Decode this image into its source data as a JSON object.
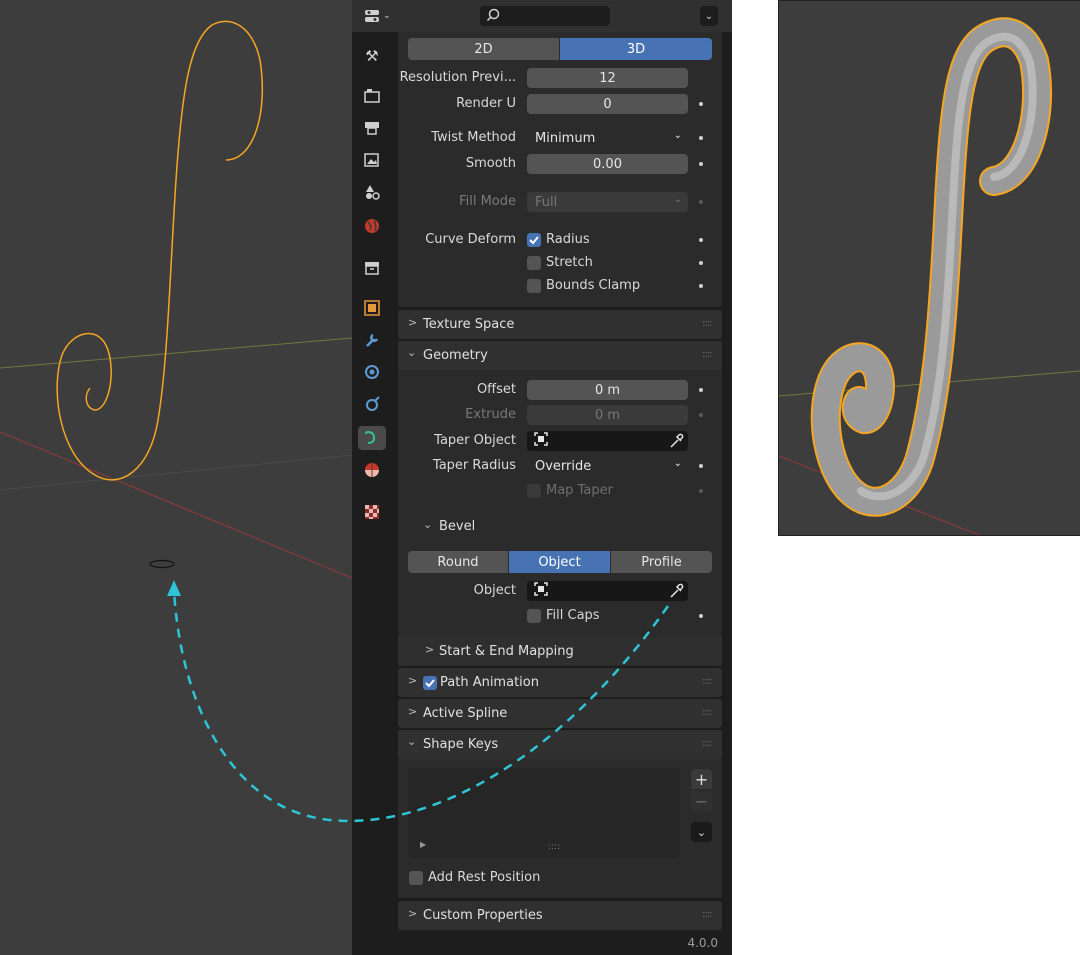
{
  "header": {
    "editor_type_icon": "properties-editor-icon",
    "search_placeholder": ""
  },
  "tabs": [
    {
      "name": "tool-tab",
      "icon": "wrench-screwdriver-icon"
    },
    {
      "name": "render-tab",
      "icon": "camera-back-icon"
    },
    {
      "name": "output-tab",
      "icon": "printer-icon"
    },
    {
      "name": "view-layer-tab",
      "icon": "image-stack-icon"
    },
    {
      "name": "scene-tab",
      "icon": "shapes-icon"
    },
    {
      "name": "world-tab",
      "icon": "globe-icon"
    },
    {
      "name": "collection-tab",
      "icon": "box-icon"
    },
    {
      "name": "object-tab",
      "icon": "orange-square-icon"
    },
    {
      "name": "modifier-tab",
      "icon": "wrench-icon"
    },
    {
      "name": "particles-tab",
      "icon": "physics-circle-icon"
    },
    {
      "name": "constraints-tab",
      "icon": "constraint-icon"
    },
    {
      "name": "data-tab",
      "icon": "curve-icon"
    },
    {
      "name": "material-tab",
      "icon": "material-sphere-icon"
    },
    {
      "name": "texture-tab",
      "icon": "checker-icon"
    }
  ],
  "shape": {
    "mode_2d": "2D",
    "mode_3d": "3D",
    "resolution_preview_label": "Resolution Previ...",
    "resolution_preview_value": "12",
    "render_u_label": "Render U",
    "render_u_value": "0",
    "twist_method_label": "Twist Method",
    "twist_method_value": "Minimum",
    "smooth_label": "Smooth",
    "smooth_value": "0.00",
    "fill_mode_label": "Fill Mode",
    "fill_mode_value": "Full",
    "curve_deform_label": "Curve Deform",
    "radius_label": "Radius",
    "stretch_label": "Stretch",
    "bounds_clamp_label": "Bounds Clamp"
  },
  "texture_space": {
    "title": "Texture Space"
  },
  "geometry": {
    "title": "Geometry",
    "offset_label": "Offset",
    "offset_value": "0 m",
    "extrude_label": "Extrude",
    "extrude_value": "0 m",
    "taper_object_label": "Taper Object",
    "taper_radius_label": "Taper Radius",
    "taper_radius_value": "Override",
    "map_taper_label": "Map Taper"
  },
  "bevel": {
    "title": "Bevel",
    "mode_round": "Round",
    "mode_object": "Object",
    "mode_profile": "Profile",
    "object_label": "Object",
    "fill_caps_label": "Fill Caps"
  },
  "start_end_mapping": {
    "title": "Start & End Mapping"
  },
  "path_animation": {
    "title": "Path Animation"
  },
  "active_spline": {
    "title": "Active Spline"
  },
  "shape_keys": {
    "title": "Shape Keys",
    "add_rest_position_label": "Add Rest Position"
  },
  "custom_properties": {
    "title": "Custom Properties"
  },
  "status": {
    "version": "4.0.0"
  },
  "colors": {
    "accent": "#4772b3",
    "curve_outline": "#f5a623",
    "arrow": "#2ec4d6",
    "viewport_bg": "#3d3d3d"
  }
}
